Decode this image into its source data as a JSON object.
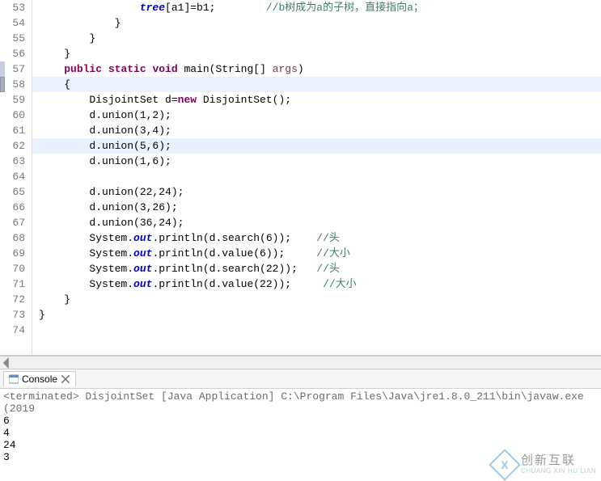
{
  "editor": {
    "lines": [
      {
        "n": "53",
        "indent": "                ",
        "segs": [
          {
            "t": "tree",
            "c": "sfield"
          },
          {
            "t": "[a1]=b1;        "
          },
          {
            "t": "//b树成为a的子树，直接指向a；",
            "c": "comment"
          }
        ]
      },
      {
        "n": "54",
        "indent": "            ",
        "segs": [
          {
            "t": "}"
          }
        ]
      },
      {
        "n": "55",
        "indent": "        ",
        "segs": [
          {
            "t": "}"
          }
        ]
      },
      {
        "n": "56",
        "indent": "    ",
        "segs": [
          {
            "t": "}"
          }
        ]
      },
      {
        "n": "57",
        "indent": "    ",
        "segs": [
          {
            "t": "public ",
            "c": "kw"
          },
          {
            "t": "static ",
            "c": "kw"
          },
          {
            "t": "void",
            "c": "kw"
          },
          {
            "t": " main(String[] "
          },
          {
            "t": "args",
            "c": "arg"
          },
          {
            "t": ")"
          }
        ],
        "marker": true
      },
      {
        "n": "58",
        "indent": "    ",
        "segs": [
          {
            "t": "{"
          }
        ],
        "hl": "hl"
      },
      {
        "n": "59",
        "indent": "        ",
        "segs": [
          {
            "t": "DisjointSet d="
          },
          {
            "t": "new",
            "c": "kw"
          },
          {
            "t": " DisjointSet();"
          }
        ]
      },
      {
        "n": "60",
        "indent": "        ",
        "segs": [
          {
            "t": "d.union(1,2);"
          }
        ]
      },
      {
        "n": "61",
        "indent": "        ",
        "segs": [
          {
            "t": "d.union(3,4);"
          }
        ]
      },
      {
        "n": "62",
        "indent": "        ",
        "segs": [
          {
            "t": "d.union(5,6);"
          }
        ],
        "hl": "hl"
      },
      {
        "n": "63",
        "indent": "        ",
        "segs": [
          {
            "t": "d.union(1,6);"
          }
        ]
      },
      {
        "n": "64",
        "indent": "        ",
        "segs": []
      },
      {
        "n": "65",
        "indent": "        ",
        "segs": [
          {
            "t": "d.union(22,24);"
          }
        ]
      },
      {
        "n": "66",
        "indent": "        ",
        "segs": [
          {
            "t": "d.union(3,26);"
          }
        ]
      },
      {
        "n": "67",
        "indent": "        ",
        "segs": [
          {
            "t": "d.union(36,24);"
          }
        ]
      },
      {
        "n": "68",
        "indent": "        ",
        "segs": [
          {
            "t": "System."
          },
          {
            "t": "out",
            "c": "sfield"
          },
          {
            "t": ".println(d.search(6));    "
          },
          {
            "t": "//头",
            "c": "comment"
          }
        ]
      },
      {
        "n": "69",
        "indent": "        ",
        "segs": [
          {
            "t": "System."
          },
          {
            "t": "out",
            "c": "sfield"
          },
          {
            "t": ".println(d.value(6));     "
          },
          {
            "t": "//大小",
            "c": "comment"
          }
        ]
      },
      {
        "n": "70",
        "indent": "        ",
        "segs": [
          {
            "t": "System."
          },
          {
            "t": "out",
            "c": "sfield"
          },
          {
            "t": ".println(d.search(22));   "
          },
          {
            "t": "//头",
            "c": "comment"
          }
        ]
      },
      {
        "n": "71",
        "indent": "        ",
        "segs": [
          {
            "t": "System."
          },
          {
            "t": "out",
            "c": "sfield"
          },
          {
            "t": ".println(d.value(22));     "
          },
          {
            "t": "//大小",
            "c": "comment"
          }
        ]
      },
      {
        "n": "72",
        "indent": "    ",
        "segs": [
          {
            "t": "}"
          }
        ]
      },
      {
        "n": "73",
        "indent": "",
        "segs": [
          {
            "t": "}"
          }
        ]
      },
      {
        "n": "74",
        "indent": "",
        "segs": []
      }
    ]
  },
  "console": {
    "tab_label": "Console",
    "status": "<terminated> DisjointSet [Java Application] C:\\Program Files\\Java\\jre1.8.0_211\\bin\\javaw.exe (2019",
    "output": [
      "6",
      "4",
      "24",
      "3"
    ]
  },
  "watermark": {
    "cn": "创新互联",
    "en": "CHUANG XIN HU LIAN"
  }
}
